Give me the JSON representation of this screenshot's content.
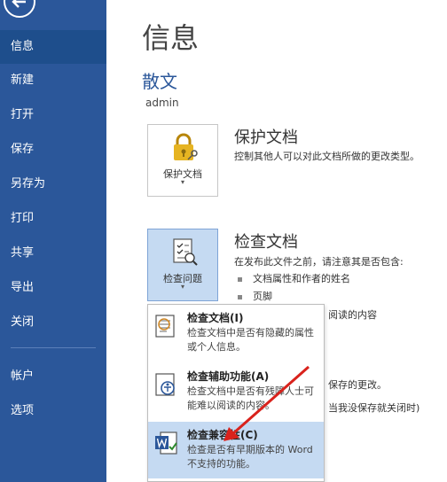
{
  "sidebar": {
    "items": [
      {
        "label": "信息"
      },
      {
        "label": "新建"
      },
      {
        "label": "打开"
      },
      {
        "label": "保存"
      },
      {
        "label": "另存为"
      },
      {
        "label": "打印"
      },
      {
        "label": "共享"
      },
      {
        "label": "导出"
      },
      {
        "label": "关闭"
      },
      {
        "label": "帐户"
      },
      {
        "label": "选项"
      }
    ]
  },
  "main": {
    "page_title": "信息",
    "doc_title": "散文",
    "doc_path": "admin",
    "protect": {
      "button_label": "保护文档",
      "title": "保护文档",
      "desc": "控制其他人可以对此文档所做的更改类型。"
    },
    "inspect": {
      "button_label": "检查问题",
      "title": "检查文档",
      "desc": "在发布此文件之前，请注意其是否包含:",
      "bullets": [
        "文档属性和作者的姓名",
        "页脚"
      ],
      "partial_1": "阅读的内容",
      "partial_2": "保存的更改。",
      "partial_3": "当我没保存就关闭时)"
    }
  },
  "dropdown": {
    "items": [
      {
        "title": "检查文档(I)",
        "desc": "检查文档中是否有隐藏的属性或个人信息。"
      },
      {
        "title": "检查辅助功能(A)",
        "desc": "检查文档中是否有残障人士可能难以阅读的内容。"
      },
      {
        "title": "检查兼容性(C)",
        "desc": "检查是否有早期版本的 Word 不支持的功能。"
      }
    ]
  },
  "colors": {
    "sidebar": "#2b579a",
    "accent": "#2b579a",
    "hover": "#c5daf2",
    "arrow": "#d9221c"
  }
}
